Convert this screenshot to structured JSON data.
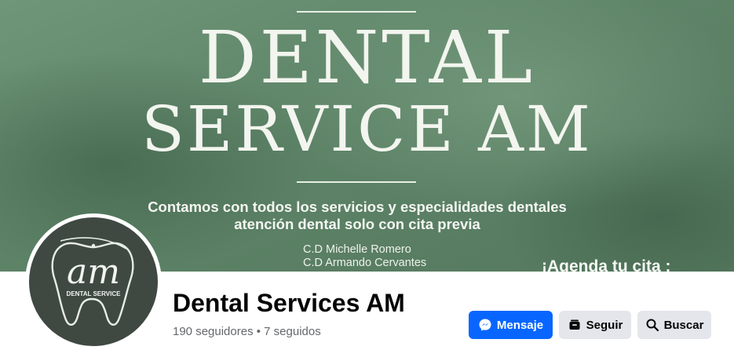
{
  "cover": {
    "title_line1": "DENTAL",
    "title_line2": "SERVICE AM",
    "tagline1": "Contamos con todos los servicios y especialidades dentales",
    "tagline2": "atención dental solo con cita previa",
    "doctor1": "C.D Michelle Romero",
    "doctor2": "C.D Armando Cervantes",
    "cta": "¡Agenda tu cita :"
  },
  "avatar": {
    "logo_text": "am",
    "logo_sub": "DENTAL SERVICE"
  },
  "page": {
    "name": "Dental Services AM",
    "stats": "190 seguidores • 7 seguidos"
  },
  "actions": {
    "message_label": "Mensaje",
    "follow_label": "Seguir",
    "search_label": "Buscar"
  },
  "colors": {
    "primary": "#0866ff",
    "secondary": "#e4e6eb",
    "cover_green": "#5e8468"
  },
  "icons": {
    "message": "messenger-icon",
    "follow": "follow-icon",
    "search": "search-icon"
  }
}
